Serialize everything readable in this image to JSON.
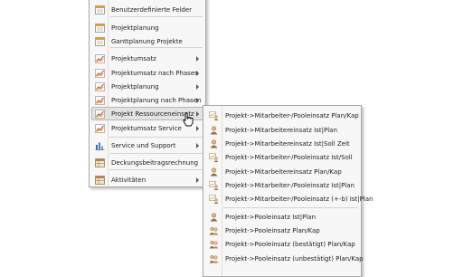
{
  "main_menu": {
    "items": [
      {
        "label": "Benutzerdefinierte Felder",
        "icon": "form-icon",
        "submenu": false
      },
      {
        "label": "Projektplanung",
        "icon": "form-icon",
        "submenu": false
      },
      {
        "label": "Ganttplanung Projekte",
        "icon": "form-icon",
        "submenu": false
      },
      {
        "label": "Projektumsatz",
        "icon": "chart-icon",
        "submenu": true
      },
      {
        "label": "Projektumsatz nach Phasen",
        "icon": "chart-icon",
        "submenu": true
      },
      {
        "label": "Projektplanung",
        "icon": "chart-icon",
        "submenu": true
      },
      {
        "label": "Projektplanung nach Phasen",
        "icon": "chart-icon",
        "submenu": true
      },
      {
        "label": "Projekt Ressourceneinsatz",
        "icon": "chart-icon",
        "submenu": true,
        "highlighted": true
      },
      {
        "label": "Projektumsatz Service",
        "icon": "chart-icon",
        "submenu": true
      },
      {
        "label": "Service und Support",
        "icon": "bar-chart-icon",
        "submenu": true
      },
      {
        "label": "Deckungsbeitragsrechnung",
        "icon": "table-icon",
        "submenu": false
      },
      {
        "label": "Aktivitäten",
        "icon": "table-icon",
        "submenu": true
      }
    ]
  },
  "sub_menu": {
    "items": [
      {
        "label": "Projekt->Mitarbeiter-/Pooleinsatz Plan/Kap",
        "icon": "people-chart-icon"
      },
      {
        "label": "Projekt->Mitarbeitereinsatz Ist|Plan",
        "icon": "person-icon"
      },
      {
        "label": "Projekt->Mitarbeitereinsatz Ist|Soll Zeit",
        "icon": "person-icon"
      },
      {
        "label": "Projekt->Mitarbeiter-/Pooleinsatz Ist/Soll",
        "icon": "people-chart-icon"
      },
      {
        "label": "Projekt->Mitarbeitereinsatz Plan/Kap",
        "icon": "person-icon"
      },
      {
        "label": "Projekt->Mitarbeiter-/Pooleinsatz Ist|Plan",
        "icon": "people-chart-icon"
      },
      {
        "label": "Projekt->Mitarbeiter-/Pooleinsatz (+-b) Ist|Plan",
        "icon": "people-chart-icon"
      },
      {
        "label": "Projekt->Pooleinsatz Ist|Plan",
        "icon": "person-icon"
      },
      {
        "label": "Projekt->Pooleinsatz Plan/Kap",
        "icon": "group-icon"
      },
      {
        "label": "Projekt->Pooleinsatz (bestätigt) Plan/Kap",
        "icon": "group-icon"
      },
      {
        "label": "Projekt->Pooleinsatz (unbestätigt) Plan/Kap",
        "icon": "group-icon"
      }
    ]
  },
  "colors": {
    "menu_bg": "#f7f7f7",
    "highlight": "#e3e3e3",
    "chart_red": "#d04a2a",
    "chart_yellow": "#e8b530",
    "form_orange": "#e89a2c",
    "person_brown": "#9a6a3a"
  }
}
